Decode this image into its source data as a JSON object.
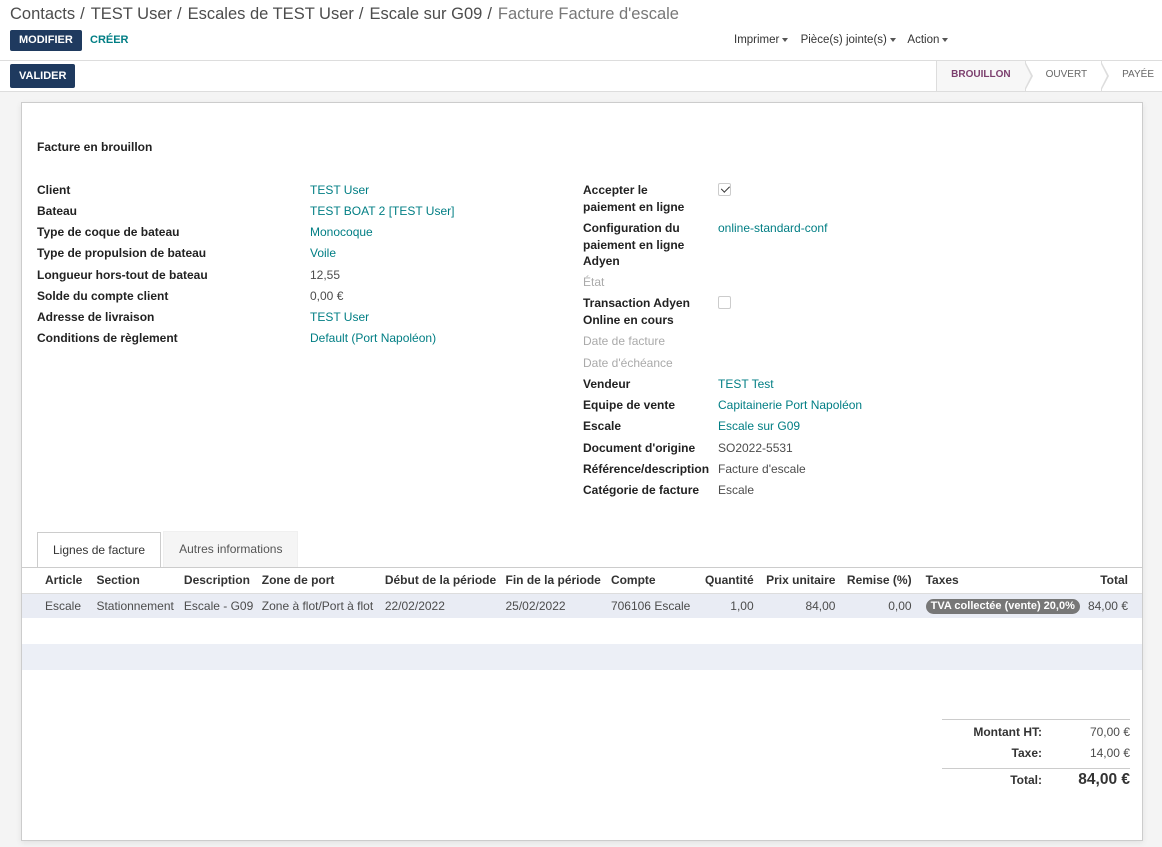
{
  "breadcrumb": [
    {
      "label": "Contacts"
    },
    {
      "label": "TEST User"
    },
    {
      "label": "Escales de TEST User"
    },
    {
      "label": "Escale sur G09"
    },
    {
      "label": "Facture Facture d'escale"
    }
  ],
  "toolbar": {
    "edit_label": "MODIFIER",
    "create_label": "CRÉER"
  },
  "sidebar_menus": {
    "print": "Imprimer",
    "attachments": "Pièce(s) jointe(s)",
    "action": "Action"
  },
  "statusbar": {
    "validate_label": "VALIDER",
    "stages": [
      {
        "label": "BROUILLON",
        "current": true
      },
      {
        "label": "OUVERT",
        "current": false
      },
      {
        "label": "PAYÉE",
        "current": false
      }
    ]
  },
  "form": {
    "title": "Facture en brouillon",
    "left_fields": [
      {
        "label": "Client",
        "value": "TEST User",
        "link": true
      },
      {
        "label": "Bateau",
        "value": "TEST BOAT 2 [TEST User]",
        "link": true
      },
      {
        "label": "Type de coque de bateau",
        "value": "Monocoque",
        "link": true
      },
      {
        "label": "Type de propulsion de bateau",
        "value": "Voile",
        "link": true
      },
      {
        "label": "Longueur hors-tout de bateau",
        "value": "12,55",
        "link": false
      },
      {
        "label": "Solde du compte client",
        "value": "0,00 €",
        "link": false
      },
      {
        "label": "Adresse de livraison",
        "value": "TEST User",
        "link": true
      },
      {
        "label": "Conditions de règlement",
        "value": "Default (Port Napoléon)",
        "link": true
      }
    ],
    "right_fields": {
      "online_payment": {
        "label": "Accepter le paiement en ligne",
        "checked": true
      },
      "adyen_config": {
        "label": "Configuration du paiement en ligne Adyen",
        "value": "online-standard-conf"
      },
      "state": {
        "label": "État"
      },
      "adyen_transaction": {
        "label": "Transaction Adyen Online en cours",
        "checked": false
      },
      "invoice_date": {
        "label": "Date de facture"
      },
      "due_date": {
        "label": "Date d'échéance"
      },
      "salesperson": {
        "label": "Vendeur",
        "value": "TEST Test"
      },
      "sales_team": {
        "label": "Equipe de vente",
        "value": "Capitainerie Port Napoléon"
      },
      "stopover": {
        "label": "Escale",
        "value": "Escale sur G09"
      },
      "origin": {
        "label": "Document d'origine",
        "value": "SO2022-5531"
      },
      "reference": {
        "label": "Référence/description",
        "value": "Facture d'escale"
      },
      "category": {
        "label": "Catégorie de facture",
        "value": "Escale"
      }
    }
  },
  "tabs": [
    {
      "label": "Lignes de facture",
      "active": true
    },
    {
      "label": "Autres informations",
      "active": false
    }
  ],
  "lines_table": {
    "columns": [
      "Article",
      "Section",
      "Description",
      "Zone de port",
      "Début de la période",
      "Fin de la période",
      "Compte",
      "Quantité",
      "Prix unitaire",
      "Remise (%)",
      "Taxes",
      "Total"
    ],
    "rows": [
      {
        "article": "Escale",
        "section": "Stationnement",
        "description": "Escale - G09",
        "zone": "Zone à flot/Port à flot",
        "start": "22/02/2022",
        "end": "25/02/2022",
        "account": "706106 Escale",
        "quantity": "1,00",
        "unit_price": "84,00",
        "discount": "0,00",
        "tax": "TVA collectée (vente) 20,0%",
        "total": "84,00 €"
      }
    ]
  },
  "totals": {
    "untaxed_label": "Montant HT:",
    "untaxed_value": "70,00 €",
    "tax_label": "Taxe:",
    "tax_value": "14,00 €",
    "total_label": "Total:",
    "total_value": "84,00 €"
  },
  "colors": {
    "primary": "#1f3a5f",
    "link": "#017e84",
    "current_stage": "#7c3f6e"
  }
}
